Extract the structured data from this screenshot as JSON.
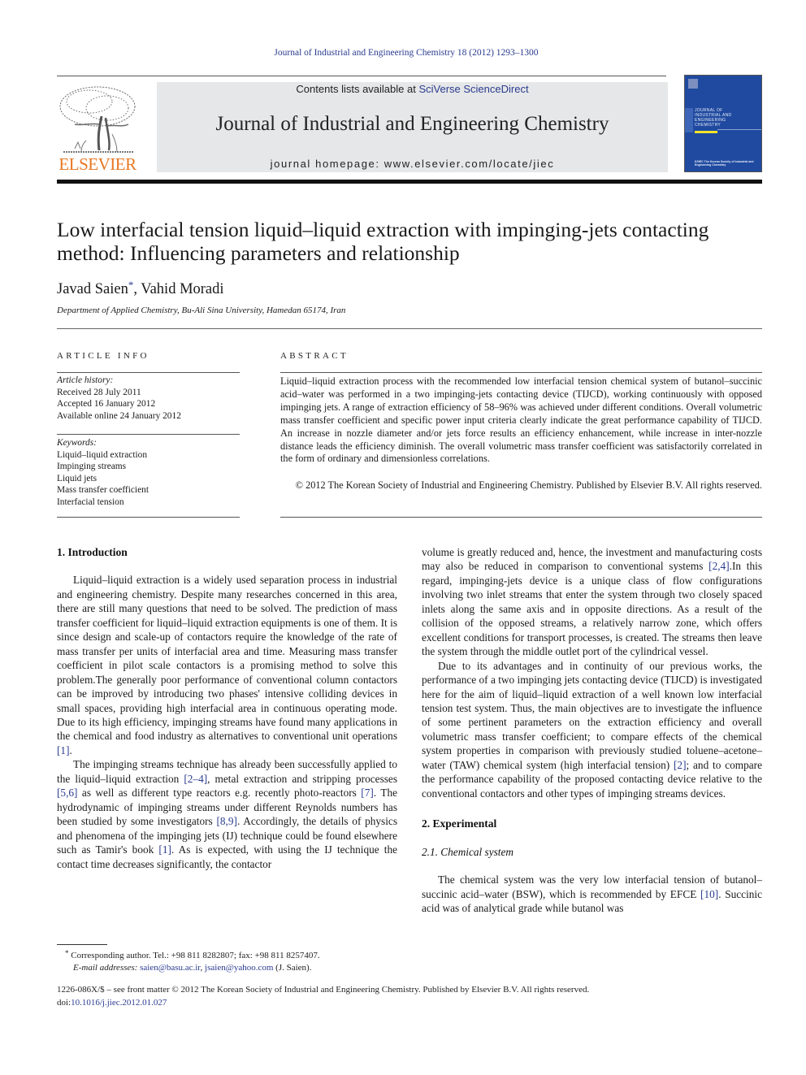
{
  "running_head": "Journal of Industrial and Engineering Chemistry 18 (2012) 1293–1300",
  "header": {
    "publisher_logo_text": "ELSEVIER",
    "contents_prefix": "Contents lists available at ",
    "contents_link": "SciVerse ScienceDirect",
    "journal_title": "Journal of Industrial and Engineering Chemistry",
    "homepage": "journal homepage: www.elsevier.com/locate/jiec",
    "cover": {
      "title_lines": [
        "JOURNAL OF",
        "INDUSTRIAL AND",
        "ENGINEERING",
        "CHEMISTRY"
      ],
      "society": "KSIEC The Korean Society of Industrial and Engineering Chemistry",
      "background_color": "#1f4aa0",
      "accent_color": "#f4e22a"
    }
  },
  "article": {
    "title": "Low interfacial tension liquid–liquid extraction with impinging-jets contacting method: Influencing parameters and relationship",
    "authors": [
      {
        "name": "Javad Saien",
        "marker": "*"
      },
      {
        "name": "Vahid Moradi",
        "marker": ""
      }
    ],
    "author_separator": ", ",
    "affiliation": "Department of Applied Chemistry, Bu-Ali Sina University, Hamedan 65174, Iran"
  },
  "article_info": {
    "heading": "ARTICLE INFO",
    "history_label": "Article history:",
    "history": [
      "Received 28 July 2011",
      "Accepted 16 January 2012",
      "Available online 24 January 2012"
    ],
    "keywords_label": "Keywords:",
    "keywords": [
      "Liquid–liquid extraction",
      "Impinging streams",
      "Liquid jets",
      "Mass transfer coefficient",
      "Interfacial tension"
    ]
  },
  "abstract": {
    "heading": "ABSTRACT",
    "text": "Liquid–liquid extraction process with the recommended low interfacial tension chemical system of butanol–succinic acid–water was performed in a two impinging-jets contacting device (TIJCD), working continuously with opposed impinging jets. A range of extraction efficiency of 58–96% was achieved under different conditions. Overall volumetric mass transfer coefficient and specific power input criteria clearly indicate the great performance capability of TIJCD. An increase in nozzle diameter and/or jets force results an efficiency enhancement, while increase in inter-nozzle distance leads the efficiency diminish. The overall volumetric mass transfer coefficient was satisfactorily correlated in the form of ordinary and dimensionless correlations.",
    "copyright": "© 2012 The Korean Society of Industrial and Engineering Chemistry. Published by Elsevier B.V. All rights reserved."
  },
  "body": {
    "section1_heading": "1.  Introduction",
    "p1": [
      {
        "t": "Liquid–liquid extraction is a widely used separation process in industrial and engineering chemistry. Despite many researches concerned in this area, there are still many questions that need to be solved. The prediction of mass transfer coefficient for liquid–liquid extraction equipments is one of them. It is since design and scale-up of contactors require the knowledge of the rate of mass transfer per units of interfacial area and time. Measuring mass transfer coefficient in pilot scale contactors is a promising method to solve this problem.The generally poor performance of conventional column contactors can be improved by introducing two phases' intensive colliding devices in small spaces, providing high interfacial area in continuous operating mode. Due to its high efficiency, impinging streams have found many applications in the chemical and food industry as alternatives to conventional unit operations "
      },
      {
        "ref": "[1]"
      },
      {
        "t": "."
      }
    ],
    "p2": [
      {
        "t": "The impinging streams technique has already been successfully applied to the liquid–liquid extraction "
      },
      {
        "ref": "[2–4]"
      },
      {
        "t": ", metal extraction and stripping processes "
      },
      {
        "ref": "[5,6]"
      },
      {
        "t": " as well as different type reactors e.g. recently photo-reactors "
      },
      {
        "ref": "[7]"
      },
      {
        "t": ". The hydrodynamic of impinging streams under different Reynolds numbers has been studied by some investigators "
      },
      {
        "ref": "[8,9]"
      },
      {
        "t": ". Accordingly, the details of physics and phenomena of the impinging jets (IJ) technique could be found elsewhere such as Tamir's book "
      },
      {
        "ref": "[1]"
      },
      {
        "t": ". As is expected, with using the IJ technique the contact time decreases significantly, the contactor"
      }
    ],
    "p3": [
      {
        "t": "volume is greatly reduced and, hence, the investment and manufacturing costs may also be reduced in comparison to conventional systems "
      },
      {
        "ref": "[2,4]"
      },
      {
        "t": ".In this regard, impinging-jets device is a unique class of flow configurations involving two inlet streams that enter the system through two closely spaced inlets along the same axis and in opposite directions. As a result of the collision of the opposed streams, a relatively narrow zone, which offers excellent conditions for transport processes, is created. The streams then leave the system through the middle outlet port of the cylindrical vessel."
      }
    ],
    "p4": [
      {
        "t": "Due to its advantages and in continuity of our previous works, the performance of a two impinging jets contacting device (TIJCD) is investigated here for the aim of liquid–liquid extraction of a well known low interfacial tension test system. Thus, the main objectives are to investigate the influence of some pertinent parameters on the extraction efficiency and overall volumetric mass transfer coefficient; to compare effects of the chemical system properties in comparison with previously studied toluene–acetone–water (TAW) chemical system (high interfacial tension) "
      },
      {
        "ref": "[2]"
      },
      {
        "t": "; and to compare the performance capability of the proposed contacting device relative to the conventional contactors and other types of impinging streams devices."
      }
    ],
    "section2_heading": "2.  Experimental",
    "subsection21_heading": "2.1.  Chemical system",
    "p5": [
      {
        "t": "The chemical system was the very low interfacial tension of butanol–succinic acid–water (BSW), which is recommended by EFCE "
      },
      {
        "ref": "[10]"
      },
      {
        "t": ". Succinic acid was of analytical grade while butanol was"
      }
    ]
  },
  "footnote": {
    "marker": "*",
    "line1": "Corresponding author. Tel.: +98 811 8282807; fax: +98 811 8257407.",
    "email_label": "E-mail addresses:",
    "emails": [
      "saien@basu.ac.ir",
      "jsaien@yahoo.com"
    ],
    "email_suffix": " (J. Saien)."
  },
  "bottom_meta": {
    "issn_line": "1226-086X/$ – see front matter © 2012 The Korean Society of Industrial and Engineering Chemistry. Published by Elsevier B.V. All rights reserved.",
    "doi_label": "doi:",
    "doi": "10.1016/j.jiec.2012.01.027"
  },
  "colors": {
    "link": "#2a3b8f",
    "elsevier_orange": "#e87722",
    "banner_gray": "#e6e7e8"
  }
}
